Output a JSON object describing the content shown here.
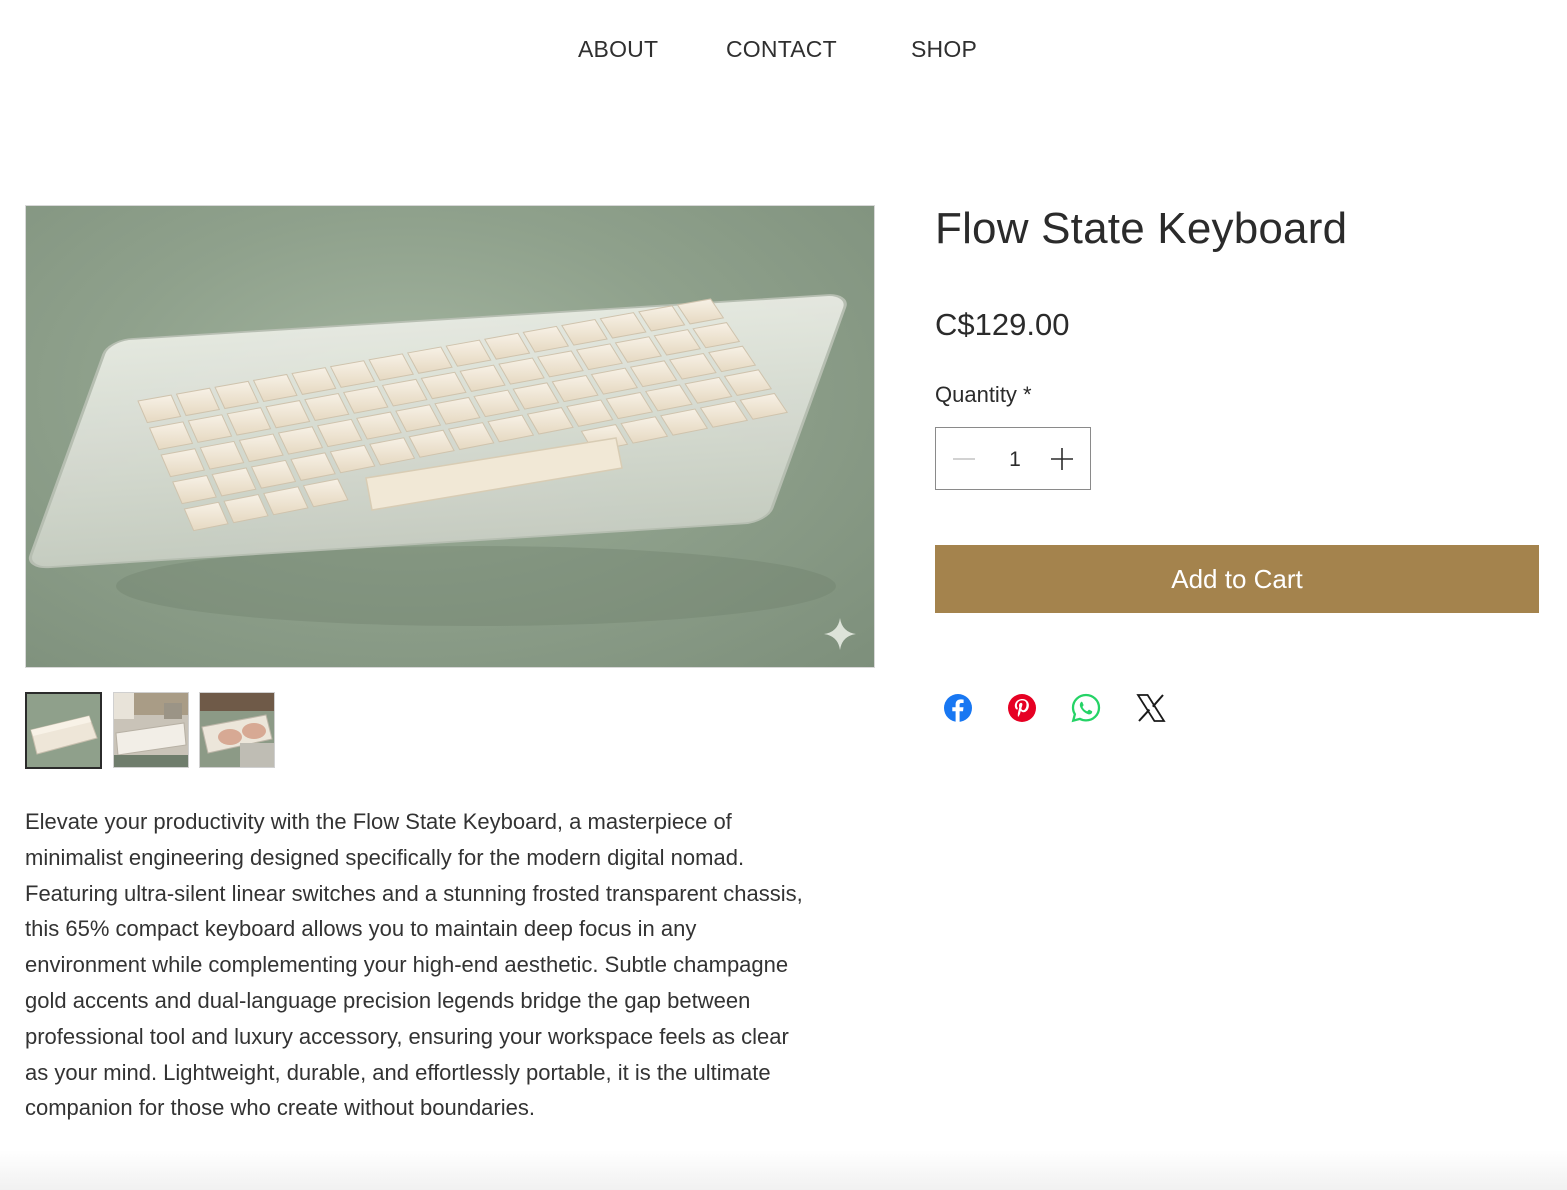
{
  "nav": {
    "items": [
      "ABOUT",
      "CONTACT",
      "SHOP"
    ]
  },
  "product": {
    "title": "Flow State Keyboard",
    "price": "C$129.00",
    "quantity_label": "Quantity *",
    "quantity_value": "1",
    "add_to_cart_label": "Add to Cart",
    "description": "Elevate your productivity with the Flow State Keyboard, a masterpiece of\nminimalist engineering designed specifically for the modern digital nomad.\nFeaturing ultra-silent linear switches and a stunning frosted transparent chassis,\nthis 65% compact keyboard allows you to maintain deep focus in any\nenvironment while complementing your high-end aesthetic. Subtle champagne\ngold accents and dual-language precision legends bridge the gap between\nprofessional tool and luxury accessory, ensuring your workspace feels as clear\nas your mind. Lightweight, durable, and effortlessly portable, it is the ultimate\ncompanion for those who create without boundaries.",
    "main_image": {
      "kind": "product-photo",
      "subject": "keyboard-on-green-mat"
    },
    "thumbnails": [
      {
        "kind": "keyboard-photo",
        "selected": true
      },
      {
        "kind": "keyboard-on-desk-photo",
        "selected": false
      },
      {
        "kind": "hands-typing-photo",
        "selected": false
      }
    ]
  },
  "share": {
    "icons": [
      "facebook-icon",
      "pinterest-icon",
      "whatsapp-icon",
      "x-icon"
    ]
  },
  "colors": {
    "accent": "#a4834d",
    "text": "#2b2b2b",
    "facebook": "#1877f2",
    "pinterest": "#e60023",
    "whatsapp": "#25d366"
  }
}
